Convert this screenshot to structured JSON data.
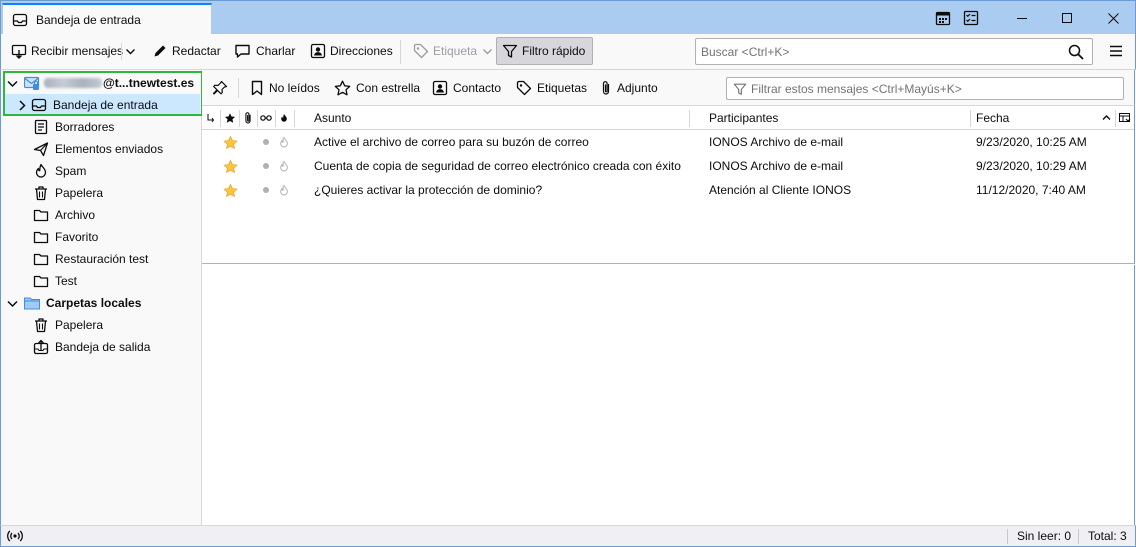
{
  "window": {
    "tab_title": "Bandeja de entrada",
    "icons": [
      "calendar-icon",
      "tasks-icon"
    ],
    "controls": [
      "minimize",
      "maximize",
      "close"
    ]
  },
  "toolbar": {
    "get_messages": "Recibir mensajes",
    "write": "Redactar",
    "chat": "Charlar",
    "address_book": "Direcciones",
    "tag": "Etiqueta",
    "quick_filter": "Filtro rápido",
    "search_placeholder": "Buscar <Ctrl+K>"
  },
  "folders": {
    "account_suffix": "@t...tnewtest.es",
    "items": [
      {
        "label": "Bandeja de entrada",
        "icon": "inbox-icon"
      },
      {
        "label": "Borradores",
        "icon": "drafts-icon"
      },
      {
        "label": "Elementos enviados",
        "icon": "sent-icon"
      },
      {
        "label": "Spam",
        "icon": "spam-icon"
      },
      {
        "label": "Papelera",
        "icon": "trash-icon"
      },
      {
        "label": "Archivo",
        "icon": "folder-icon"
      },
      {
        "label": "Favorito",
        "icon": "folder-icon"
      },
      {
        "label": "Restauración test",
        "icon": "folder-icon"
      },
      {
        "label": "Test",
        "icon": "folder-icon"
      }
    ],
    "local_folders": {
      "label": "Carpetas locales",
      "items": [
        {
          "label": "Papelera",
          "icon": "trash-icon"
        },
        {
          "label": "Bandeja de salida",
          "icon": "outbox-icon"
        }
      ]
    }
  },
  "quick_filter": {
    "unread": "No leídos",
    "starred": "Con estrella",
    "contact": "Contacto",
    "tags": "Etiquetas",
    "attachment": "Adjunto",
    "filter_placeholder": "Filtrar estos mensajes <Ctrl+Mayús+K>"
  },
  "thread_pane": {
    "columns": {
      "subject": "Asunto",
      "correspondents": "Participantes",
      "date": "Fecha"
    },
    "rows": [
      {
        "subject": "Active el archivo de correo para su buzón de correo",
        "from": "IONOS Archivo de e-mail",
        "date": "9/23/2020, 10:25 AM",
        "starred": true
      },
      {
        "subject": "Cuenta de copia de seguridad de correo electrónico creada con éxito",
        "from": "IONOS Archivo de e-mail",
        "date": "9/23/2020, 10:29 AM",
        "starred": true
      },
      {
        "subject": "¿Quieres activar la protección de dominio?",
        "from": "Atención al Cliente IONOS",
        "date": "11/12/2020, 7:40 AM",
        "starred": true
      }
    ]
  },
  "status_bar": {
    "unread": "Sin leer: 0",
    "total": "Total: 3"
  },
  "colors": {
    "accent": "#0a84ff",
    "star": "#ffc440",
    "selection": "#cce8ff",
    "highlight_box": "#2fb63f",
    "titlebar": "#a9ccf0"
  }
}
